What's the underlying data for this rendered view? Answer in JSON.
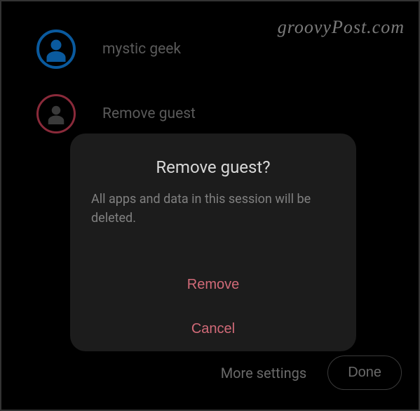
{
  "watermark": "groovyPost.com",
  "users": [
    {
      "label": "mystic geek"
    },
    {
      "label": "Remove guest"
    }
  ],
  "dialog": {
    "title": "Remove guest?",
    "message": "All apps and data in this session will be deleted.",
    "remove": "Remove",
    "cancel": "Cancel"
  },
  "footer": {
    "more_settings": "More settings",
    "done": "Done"
  }
}
